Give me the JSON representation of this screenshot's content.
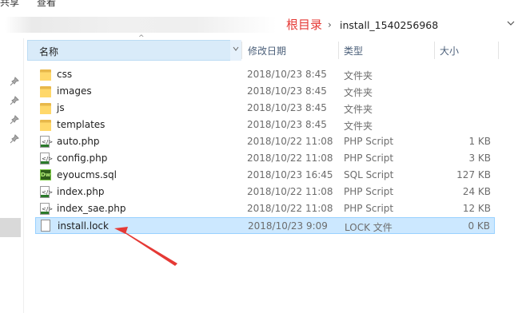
{
  "menu": {
    "partial_left": "共享",
    "partial_right": "查看"
  },
  "address": {
    "annotation": "根目录",
    "separator": "›",
    "current_folder": "install_1540256968",
    "dropdown_icon": "chevron-down-icon"
  },
  "columns": {
    "name": "名称",
    "date": "修改日期",
    "type": "类型",
    "size": "大小",
    "sort_indicator": "^"
  },
  "files": [
    {
      "name": "css",
      "date": "2018/10/23 8:45",
      "type": "文件夹",
      "size": "",
      "icon": "folder-icon"
    },
    {
      "name": "images",
      "date": "2018/10/23 8:45",
      "type": "文件夹",
      "size": "",
      "icon": "folder-icon"
    },
    {
      "name": "js",
      "date": "2018/10/23 8:45",
      "type": "文件夹",
      "size": "",
      "icon": "folder-icon"
    },
    {
      "name": "templates",
      "date": "2018/10/23 8:45",
      "type": "文件夹",
      "size": "",
      "icon": "folder-icon"
    },
    {
      "name": "auto.php",
      "date": "2018/10/22 11:08",
      "type": "PHP Script",
      "size": "1 KB",
      "icon": "php-file-icon"
    },
    {
      "name": "config.php",
      "date": "2018/10/22 11:08",
      "type": "PHP Script",
      "size": "3 KB",
      "icon": "php-file-icon"
    },
    {
      "name": "eyoucms.sql",
      "date": "2018/10/23 16:45",
      "type": "SQL Script",
      "size": "127 KB",
      "icon": "dreamweaver-file-icon"
    },
    {
      "name": "index.php",
      "date": "2018/10/22 11:08",
      "type": "PHP Script",
      "size": "24 KB",
      "icon": "php-file-icon"
    },
    {
      "name": "index_sae.php",
      "date": "2018/10/22 11:08",
      "type": "PHP Script",
      "size": "12 KB",
      "icon": "php-file-icon"
    },
    {
      "name": "install.lock",
      "date": "2018/10/23 9:09",
      "type": "LOCK 文件",
      "size": "0 KB",
      "icon": "lock-file-icon",
      "selected": true
    }
  ],
  "colors": {
    "selection": "#cce8ff",
    "annotation": "#e53935",
    "folder": "#ffd86a"
  }
}
